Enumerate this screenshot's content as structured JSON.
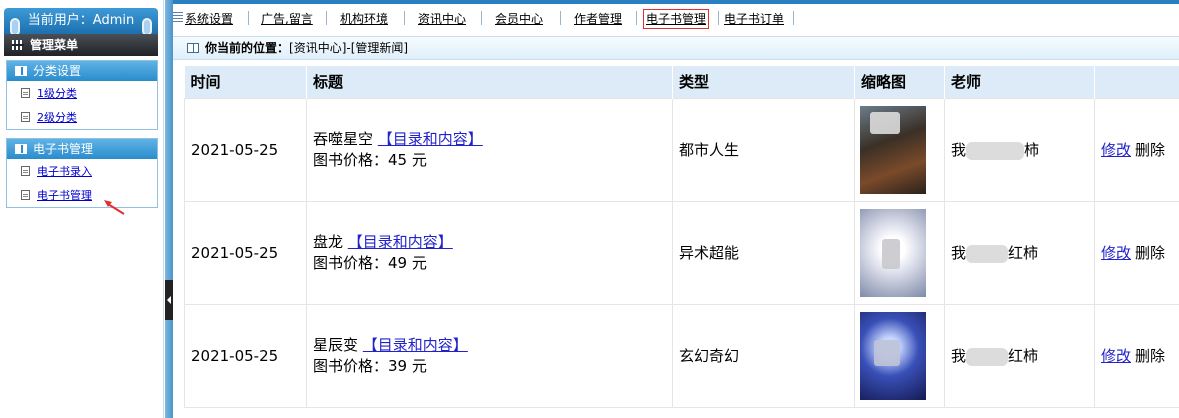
{
  "user": {
    "label": "当前用户：Admin"
  },
  "sidebar": {
    "header": "管理菜单",
    "groups": [
      {
        "title": "分类设置",
        "items": [
          {
            "label": "1级分类"
          },
          {
            "label": "2级分类"
          }
        ]
      },
      {
        "title": "电子书管理",
        "items": [
          {
            "label": "电子书录入"
          },
          {
            "label": "电子书管理"
          }
        ]
      }
    ]
  },
  "topnav": {
    "items": [
      {
        "label": "系统设置"
      },
      {
        "label": "广告,留言"
      },
      {
        "label": "机构环境"
      },
      {
        "label": "资讯中心"
      },
      {
        "label": "会员中心"
      },
      {
        "label": "作者管理"
      },
      {
        "label": "电子书管理"
      },
      {
        "label": "电子书订单"
      }
    ],
    "active": "电子书管理"
  },
  "location": {
    "prefix": "你当前的位置：",
    "path": "[资讯中心]-[管理新闻]"
  },
  "table": {
    "headers": [
      "时间",
      "标题",
      "类型",
      "缩略图",
      "老师",
      ""
    ],
    "rows": [
      {
        "time": "2021-05-25",
        "title": "吞噬星空",
        "link": "【目录和内容】",
        "price": "图书价格：45 元",
        "type": "都市人生",
        "teacher_a": "我",
        "teacher_b": "柿",
        "edit": "修改",
        "del": "删除"
      },
      {
        "time": "2021-05-25",
        "title": "盘龙",
        "link": "【目录和内容】",
        "price": "图书价格：49 元",
        "type": "异术超能",
        "teacher_a": "我",
        "teacher_b": "红柿",
        "edit": "修改",
        "del": "删除"
      },
      {
        "time": "2021-05-25",
        "title": "星辰变",
        "link": "【目录和内容】",
        "price": "图书价格：39 元",
        "type": "玄幻奇幻",
        "teacher_a": "我",
        "teacher_b": "红柿",
        "edit": "修改",
        "del": "删除"
      }
    ]
  },
  "colors": {
    "accent": "#2a7fc0",
    "header_bg": "#dcebf7",
    "active_border": "#e03030",
    "annotation": "#e03030"
  }
}
